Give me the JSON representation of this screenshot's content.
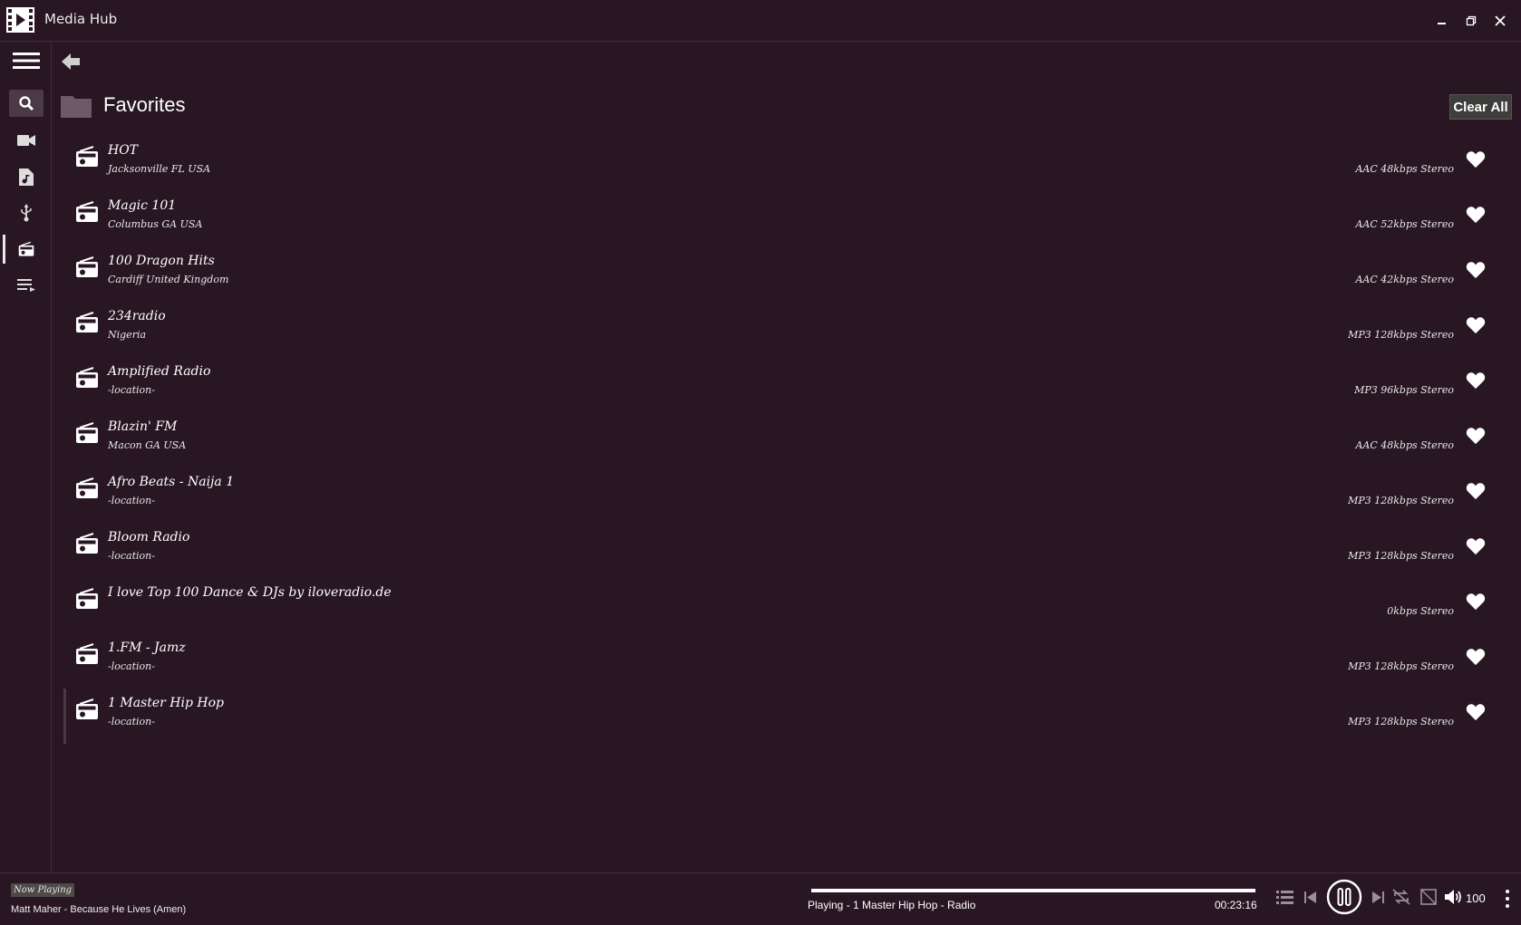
{
  "window": {
    "title": "Media Hub"
  },
  "header": {
    "title": "Favorites",
    "clear_label": "Clear All"
  },
  "stations": [
    {
      "name": "HOT",
      "location": "Jacksonville  FL  USA",
      "format": "AAC 48kbps Stereo"
    },
    {
      "name": "Magic 101",
      "location": "Columbus  GA  USA",
      "format": "AAC 52kbps Stereo"
    },
    {
      "name": "100 Dragon Hits",
      "location": "Cardiff  United Kingdom",
      "format": "AAC 42kbps Stereo"
    },
    {
      "name": "234radio",
      "location": "Nigeria",
      "format": "MP3 128kbps Stereo"
    },
    {
      "name": "Amplified Radio",
      "location": "-location-",
      "format": "MP3 96kbps Stereo"
    },
    {
      "name": "Blazin' FM",
      "location": "Macon  GA  USA",
      "format": "AAC 48kbps Stereo"
    },
    {
      "name": "Afro Beats - Naija 1",
      "location": "-location-",
      "format": "MP3 128kbps Stereo"
    },
    {
      "name": "Bloom Radio",
      "location": "-location-",
      "format": "MP3 128kbps Stereo"
    },
    {
      "name": "I love Top 100 Dance & DJs by iloveradio.de",
      "location": "",
      "format": "0kbps Stereo"
    },
    {
      "name": "1.FM - Jamz",
      "location": "-location-",
      "format": "MP3 128kbps Stereo"
    },
    {
      "name": "1 Master Hip Hop",
      "location": "-location-",
      "format": "MP3 128kbps Stereo"
    }
  ],
  "player": {
    "now_playing_label": "Now Playing",
    "track": "Matt Maher - Because He Lives (Amen)",
    "status": "Playing - 1 Master Hip Hop - Radio",
    "time": "00:23:16",
    "progress": 1.0,
    "volume": "100"
  },
  "colors": {
    "background": "#281622",
    "divider": "#3f2c38",
    "accent": "#ffffff"
  }
}
